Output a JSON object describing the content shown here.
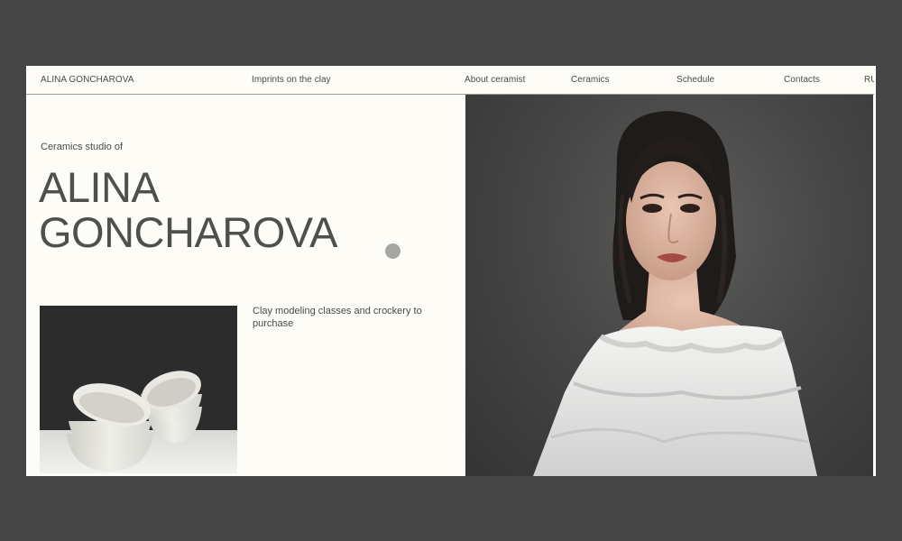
{
  "nav": {
    "brand": "ALINA GONCHAROVA",
    "items": [
      "Imprints on the clay",
      "About ceramist",
      "Ceramics",
      "Schedule",
      "Contacts",
      "RU"
    ]
  },
  "hero": {
    "subtitle": "Ceramics studio of",
    "title_line1": "ALINA",
    "title_line2": "GONCHAROVA",
    "tagline": "Clay modeling classes and crockery to purchase"
  },
  "colors": {
    "page_background": "#fdfcf7",
    "outer_background": "#454545",
    "text": "#4a4a48",
    "accent_dot": "#a5a5a3"
  }
}
